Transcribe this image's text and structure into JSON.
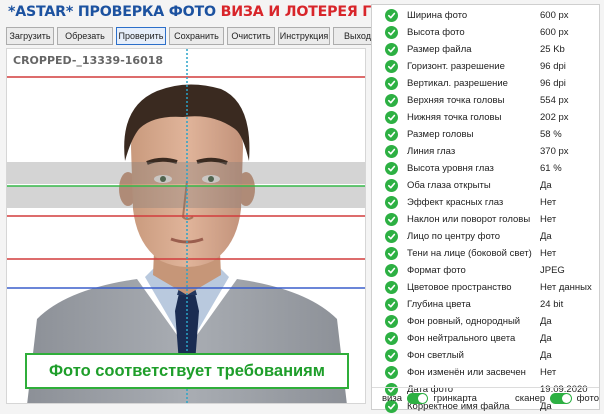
{
  "header": {
    "title_part1": "*ASTAR* ПРОВЕРКА ФОТО",
    "title_part2": "ВИЗА И ЛОТЕРЕЯ ГРИН КАРТА"
  },
  "toolbar": {
    "buttons": [
      {
        "label": "Загрузить"
      },
      {
        "label": "Обрезать"
      },
      {
        "label": "Проверить"
      },
      {
        "label": "Сохранить"
      },
      {
        "label": "Очистить"
      },
      {
        "label": "Инструкция"
      },
      {
        "label": "Выход"
      }
    ]
  },
  "photo": {
    "filename": "CROPPED-_13339-16018",
    "status_message": "Фото соответствует требованиям"
  },
  "checks": [
    {
      "label": "Ширина фото",
      "value": "600 px"
    },
    {
      "label": "Высота фото",
      "value": "600 px"
    },
    {
      "label": "Размер файла",
      "value": "25 Kb"
    },
    {
      "label": "Горизонт. разрешение",
      "value": "96 dpi"
    },
    {
      "label": "Вертикал. разрешение",
      "value": "96 dpi"
    },
    {
      "label": "Верхняя точка головы",
      "value": "554 px"
    },
    {
      "label": "Нижняя точка головы",
      "value": "202 px"
    },
    {
      "label": "Размер головы",
      "value": "58 %"
    },
    {
      "label": "Линия глаз",
      "value": "370 px"
    },
    {
      "label": "Высота уровня глаз",
      "value": "61 %"
    },
    {
      "label": "Оба глаза открыты",
      "value": "Да"
    },
    {
      "label": "Эффект красных глаз",
      "value": "Нет"
    },
    {
      "label": "Наклон или поворот головы",
      "value": "Нет"
    },
    {
      "label": "Лицо по центру фото",
      "value": "Да"
    },
    {
      "label": "Тени на лице (боковой свет)",
      "value": "Нет"
    },
    {
      "label": "Формат фото",
      "value": "JPEG"
    },
    {
      "label": "Цветовое пространство",
      "value": "Нет данных"
    },
    {
      "label": "Глубина цвета",
      "value": "24 bit"
    },
    {
      "label": "Фон ровный, однородный",
      "value": "Да"
    },
    {
      "label": "Фон нейтрального цвета",
      "value": "Да"
    },
    {
      "label": "Фон светлый",
      "value": "Да"
    },
    {
      "label": "Фон изменён или засвечен",
      "value": "Нет"
    },
    {
      "label": "Дата фото",
      "value": "19.09.2020"
    },
    {
      "label": "Корректное имя файла",
      "value": "Да"
    }
  ],
  "footer": {
    "label_visa": "виза",
    "label_greencard": "гринкарта",
    "label_scanner": "сканер",
    "label_photo": "фото",
    "toggle_visa_greencard_on": true,
    "toggle_scanner_photo_on": true
  },
  "colors": {
    "title_blue": "#1c52a0",
    "title_red": "#d8252a",
    "check_green": "#2db043",
    "status_green": "#1e9e2a"
  }
}
